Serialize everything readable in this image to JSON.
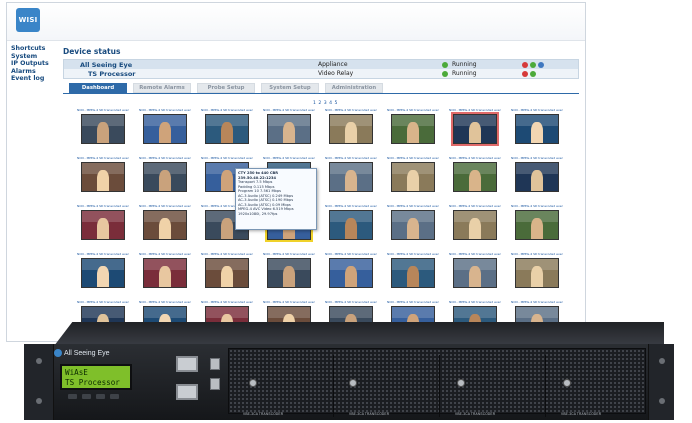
{
  "logo": {
    "text": "WISI"
  },
  "sidebar": {
    "items": [
      {
        "label": "Shortcuts"
      },
      {
        "label": "System"
      },
      {
        "label": "IP Outputs"
      },
      {
        "label": "Alarms"
      },
      {
        "label": "Event log"
      }
    ]
  },
  "device_status": {
    "title": "Device status",
    "rows": [
      {
        "name": "All Seeing Eye",
        "type": "Appliance",
        "status": "Running"
      },
      {
        "name": "TS Processor",
        "type": "Video Relay",
        "status": "Running"
      }
    ]
  },
  "tabs": [
    {
      "label": "Dashboard",
      "active": true
    },
    {
      "label": "Remote Alarms",
      "active": false
    },
    {
      "label": "Probe Setup",
      "active": false
    },
    {
      "label": "System Setup",
      "active": false
    },
    {
      "label": "Administration",
      "active": false
    }
  ],
  "pager": {
    "text": "1 2 3 4 5"
  },
  "thumbnails": {
    "caption": "NCN - MPEG-4 SD transcoded event",
    "rows": 5,
    "cols": 8
  },
  "popup": {
    "lines": [
      "CTY 250 to 440 CBR",
      "239.50.40.22:1234",
      "Transport            7.5 Mbps",
      "Padding               0.115 Mbps",
      "Program 10         7.561 Mbps",
      "  AC-3 Audio (ATSC)    0.249 Mbps",
      "  AC-3 Audio (ATSC)    0.190 Mbps",
      "  AC-3 Audio (ATSC)    0.09 Mbps",
      "  MPEG-4 AVC Video    6.519 Mbps",
      "  1920x1080i, 29.97fps"
    ]
  },
  "hardware": {
    "brand": "All Seeing Eye",
    "lcd_line1": "WiAsE",
    "lcd_line2": "TS Processor",
    "bay_labels": [
      "VBE-3CA TRANSCODER",
      "VBE-3CA TRANSCODER",
      "VBE-3CA TRANSCODER",
      "VBE-3CA TRANSCODER"
    ]
  }
}
